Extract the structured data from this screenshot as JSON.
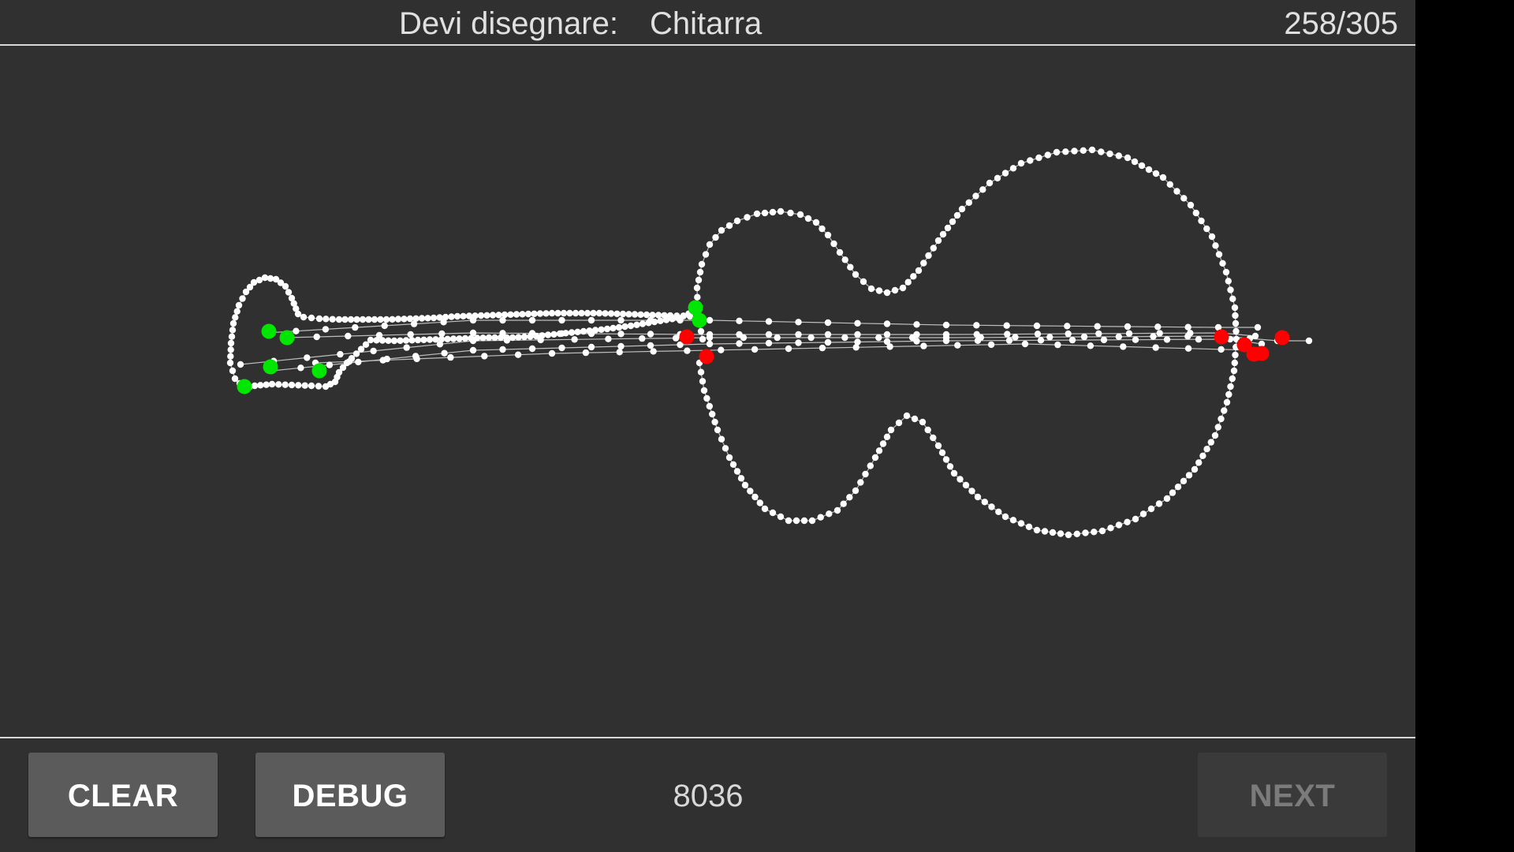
{
  "header": {
    "prompt_label": "Devi disegnare:",
    "prompt_word": "Chitarra",
    "progress": "258/305"
  },
  "canvas": {
    "point_color": "#ffffff",
    "line_color": "#bdbdbd",
    "start_marker_color": "#00e600",
    "end_marker_color": "#ff0000"
  },
  "footer": {
    "clear_label": "CLEAR",
    "debug_label": "DEBUG",
    "score": "8036",
    "next_label": "NEXT"
  },
  "colors": {
    "background": "#303030",
    "button": "#5b5b5b",
    "button_disabled": "#3a3a3a"
  }
}
